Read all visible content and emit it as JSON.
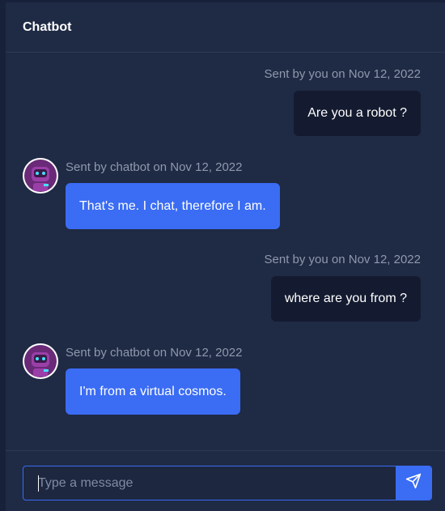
{
  "header": {
    "title": "Chatbot"
  },
  "messages": [
    {
      "sender": "user",
      "meta": "Sent by you on Nov 12, 2022",
      "text": "Are you a robot ?"
    },
    {
      "sender": "bot",
      "meta": "Sent by chatbot on  Nov 12, 2022",
      "text": "That's me. I chat, therefore I am."
    },
    {
      "sender": "user",
      "meta": "Sent by you on Nov 12, 2022",
      "text": "where are you from ?"
    },
    {
      "sender": "bot",
      "meta": "Sent by chatbot on  Nov 12, 2022",
      "text": "I'm from a virtual cosmos."
    }
  ],
  "composer": {
    "placeholder": "Type a message",
    "value": ""
  },
  "icons": {
    "send": "send-icon",
    "avatar": "robot-avatar-icon"
  },
  "colors": {
    "accent": "#3a6cf4",
    "background": "#1f2a44",
    "user_bubble": "#141b30",
    "meta_text": "#8f99ad"
  }
}
